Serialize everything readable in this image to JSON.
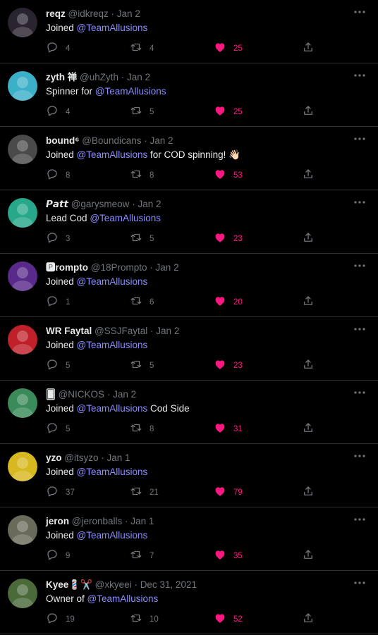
{
  "tweets": [
    {
      "name": "reqz",
      "handle": "@idkreqz",
      "date": "Jan 2",
      "text_pre": "Joined ",
      "mention": "@TeamAllusions",
      "text_post": "",
      "replies": "4",
      "retweets": "4",
      "likes": "25",
      "avatar_color": "#2a2430"
    },
    {
      "name": "zyth 禅",
      "handle": "@uhZyth",
      "date": "Jan 2",
      "text_pre": "Spinner for ",
      "mention": "@TeamAllusions",
      "text_post": "",
      "replies": "4",
      "retweets": "5",
      "likes": "25",
      "avatar_color": "#3cb0c8"
    },
    {
      "name": "bound⁶",
      "handle": "@Boundicans",
      "date": "Jan 2",
      "text_pre": "Joined ",
      "mention": "@TeamAllusions",
      "text_post": " for COD spinning! 👋🏻",
      "replies": "8",
      "retweets": "8",
      "likes": "53",
      "avatar_color": "#4a4a4a"
    },
    {
      "name": "𝙋𝙖𝙩𝙩",
      "handle": "@garysmeow",
      "date": "Jan 2",
      "text_pre": "Lead Cod ",
      "mention": "@TeamAllusions",
      "text_post": "",
      "replies": "3",
      "retweets": "5",
      "likes": "23",
      "avatar_color": "#27a88a"
    },
    {
      "name": "🅿rompto",
      "handle": "@18Prompto",
      "date": "Jan 2",
      "text_pre": "Joined ",
      "mention": "@TeamAllusions",
      "text_post": "",
      "replies": "1",
      "retweets": "6",
      "likes": "20",
      "avatar_color": "#5a2a8a"
    },
    {
      "name": "WR Faytal",
      "handle": "@SSJFaytal",
      "date": "Jan 2",
      "text_pre": "Joined ",
      "mention": "@TeamAllusions",
      "text_post": "",
      "replies": "5",
      "retweets": "5",
      "likes": "23",
      "avatar_color": "#c0202a"
    },
    {
      "name": "🂠",
      "handle": "@NICKOS",
      "date": "Jan 2",
      "text_pre": "Joined ",
      "mention": "@TeamAllusions",
      "text_post": " Cod Side",
      "replies": "5",
      "retweets": "8",
      "likes": "31",
      "avatar_color": "#3a8a5a"
    },
    {
      "name": "yzo",
      "handle": "@itsyzo",
      "date": "Jan 1",
      "text_pre": "Joined ",
      "mention": "@TeamAllusions",
      "text_post": "",
      "replies": "37",
      "retweets": "21",
      "likes": "79",
      "avatar_color": "#d8b820"
    },
    {
      "name": "jeron",
      "handle": "@jeronballs",
      "date": "Jan 1",
      "text_pre": "Joined ",
      "mention": "@TeamAllusions",
      "text_post": "",
      "replies": "9",
      "retweets": "7",
      "likes": "35",
      "avatar_color": "#6a6a5a"
    },
    {
      "name": "Kyee💈✂️",
      "handle": "@xkyeei",
      "date": "Dec 31, 2021",
      "text_pre": "Owner of ",
      "mention": "@TeamAllusions",
      "text_post": "",
      "replies": "19",
      "retweets": "10",
      "likes": "52",
      "avatar_color": "#4a6a3a"
    }
  ],
  "separator": "·",
  "icons": {
    "reply": "reply-icon",
    "retweet": "retweet-icon",
    "like": "heart-filled-icon",
    "share": "share-icon",
    "more": "more-icon"
  },
  "colors": {
    "background": "#000000",
    "like": "#f91880",
    "mention": "#8a8cff",
    "muted": "#71767b"
  }
}
